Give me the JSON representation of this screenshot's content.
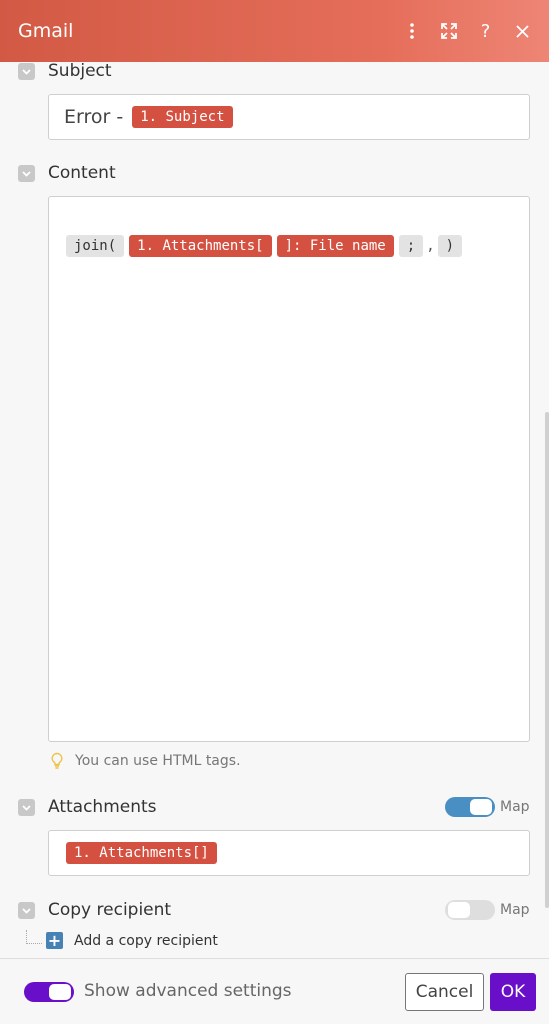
{
  "header": {
    "title": "Gmail"
  },
  "fields": {
    "subject": {
      "label": "Subject",
      "prefix": "Error -",
      "token": "1. Subject"
    },
    "content": {
      "label": "Content",
      "tokens": {
        "fn": "join(",
        "attachments": "1. Attachments[",
        "file_name": "]: File name",
        "semicolon": ";",
        "comma": ",",
        "close": ")"
      },
      "hint": "You can use HTML tags."
    },
    "attachments": {
      "label": "Attachments",
      "map_label": "Map",
      "map_on": true,
      "token": "1. Attachments[]"
    },
    "copy_recipient": {
      "label": "Copy recipient",
      "map_label": "Map",
      "map_on": false,
      "add_label": "Add a copy recipient"
    }
  },
  "footer": {
    "advanced_label": "Show advanced settings",
    "advanced_on": true,
    "cancel_label": "Cancel",
    "ok_label": "OK"
  },
  "colors": {
    "header": "#d25a45",
    "token": "#d45141",
    "accent": "#6a0fc9",
    "map_toggle": "#4a8fc4"
  }
}
